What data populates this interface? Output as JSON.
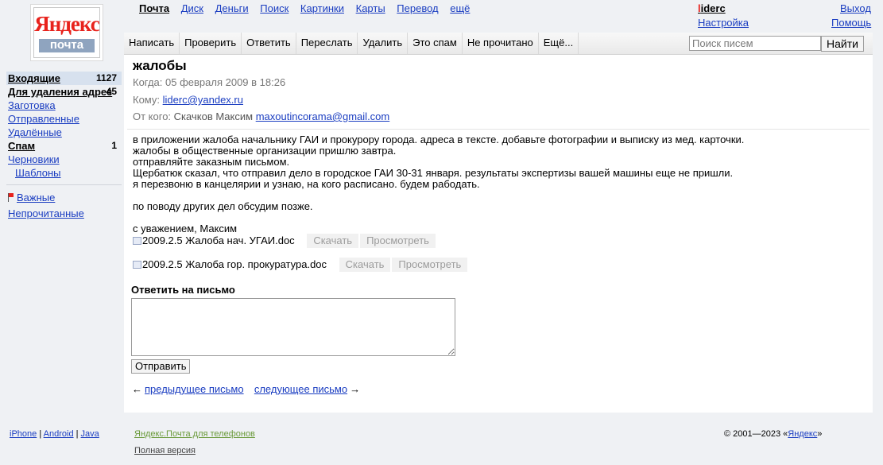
{
  "logo": {
    "brand": "Яндекс",
    "product": "почта"
  },
  "top_nav": [
    "Почта",
    "Диск",
    "Деньги",
    "Поиск",
    "Картинки",
    "Карты",
    "Перевод",
    "ещё"
  ],
  "user": {
    "login_first": "l",
    "login_rest": "iderc",
    "settings": "Настройка",
    "exit": "Выход",
    "help": "Помощь"
  },
  "toolbar": {
    "buttons": [
      "Написать",
      "Проверить",
      "Ответить",
      "Переслать",
      "Удалить",
      "Это спам",
      "Не прочитано",
      "Ещё..."
    ],
    "search_placeholder": "Поиск писем",
    "search_button": "Найти"
  },
  "sidebar": {
    "folders": [
      {
        "label": "Входящие",
        "count": "1127"
      },
      {
        "label": "Для удаления адрес",
        "count": "45"
      },
      {
        "label": "Заготовка"
      },
      {
        "label": "Отправленные"
      },
      {
        "label": "Удалённые"
      },
      {
        "label": "Спам",
        "count": "1"
      },
      {
        "label": "Черновики"
      },
      {
        "label": "Шаблоны"
      }
    ],
    "important": "Важные",
    "unread": "Непрочитанные"
  },
  "message": {
    "subject": "жалобы",
    "date_label": "Когда:",
    "date_value": "05 февраля 2009 в 18:26",
    "to_label": "Кому:",
    "to_email": "liderc@yandex.ru",
    "from_label": "От кого:",
    "from_name": "Скачков Максим",
    "from_email": "maxoutincorama@gmail.com",
    "body_lines": [
      "в приложении жалоба начальнику ГАИ и прокурору города. адреса в тексте. добавьте фотографии и выписку из мед. карточки.",
      "жалобы в общественные организации пришлю завтра.",
      "отправляйте заказным письмом.",
      "Щербатюк сказал, что отправил дело в городское ГАИ 30-31 января. результаты экспертизы вашей машины еще не пришли.",
      "я перезвоню в канцелярии и узнаю, на кого расписано. будем рабодать.",
      "",
      "по поводу других дел обсудим позже.",
      "",
      "с уважением, Максим"
    ],
    "attachments": [
      {
        "name": "2009.2.5 Жалоба нач. УГАИ.doc",
        "download": "Скачать",
        "view": "Просмотреть"
      },
      {
        "name": "2009.2.5 Жалоба гор. прокуратура.doc",
        "download": "Скачать",
        "view": "Просмотреть"
      }
    ]
  },
  "reply": {
    "title": "Ответить на письмо",
    "send": "Отправить"
  },
  "pager": {
    "prev_arrow": "←",
    "prev": "предыдущее письмо",
    "next": "следующее письмо",
    "next_arrow": "→"
  },
  "footer": {
    "iphone": "iPhone",
    "android": "Android",
    "java": "Java",
    "sep": "|",
    "mobile": "Яндекс.Почта для телефонов",
    "full": "Полная версия",
    "copyright_prefix": "© 2001—2023 «",
    "copyright_link": "Яндекс",
    "copyright_suffix": "»"
  }
}
